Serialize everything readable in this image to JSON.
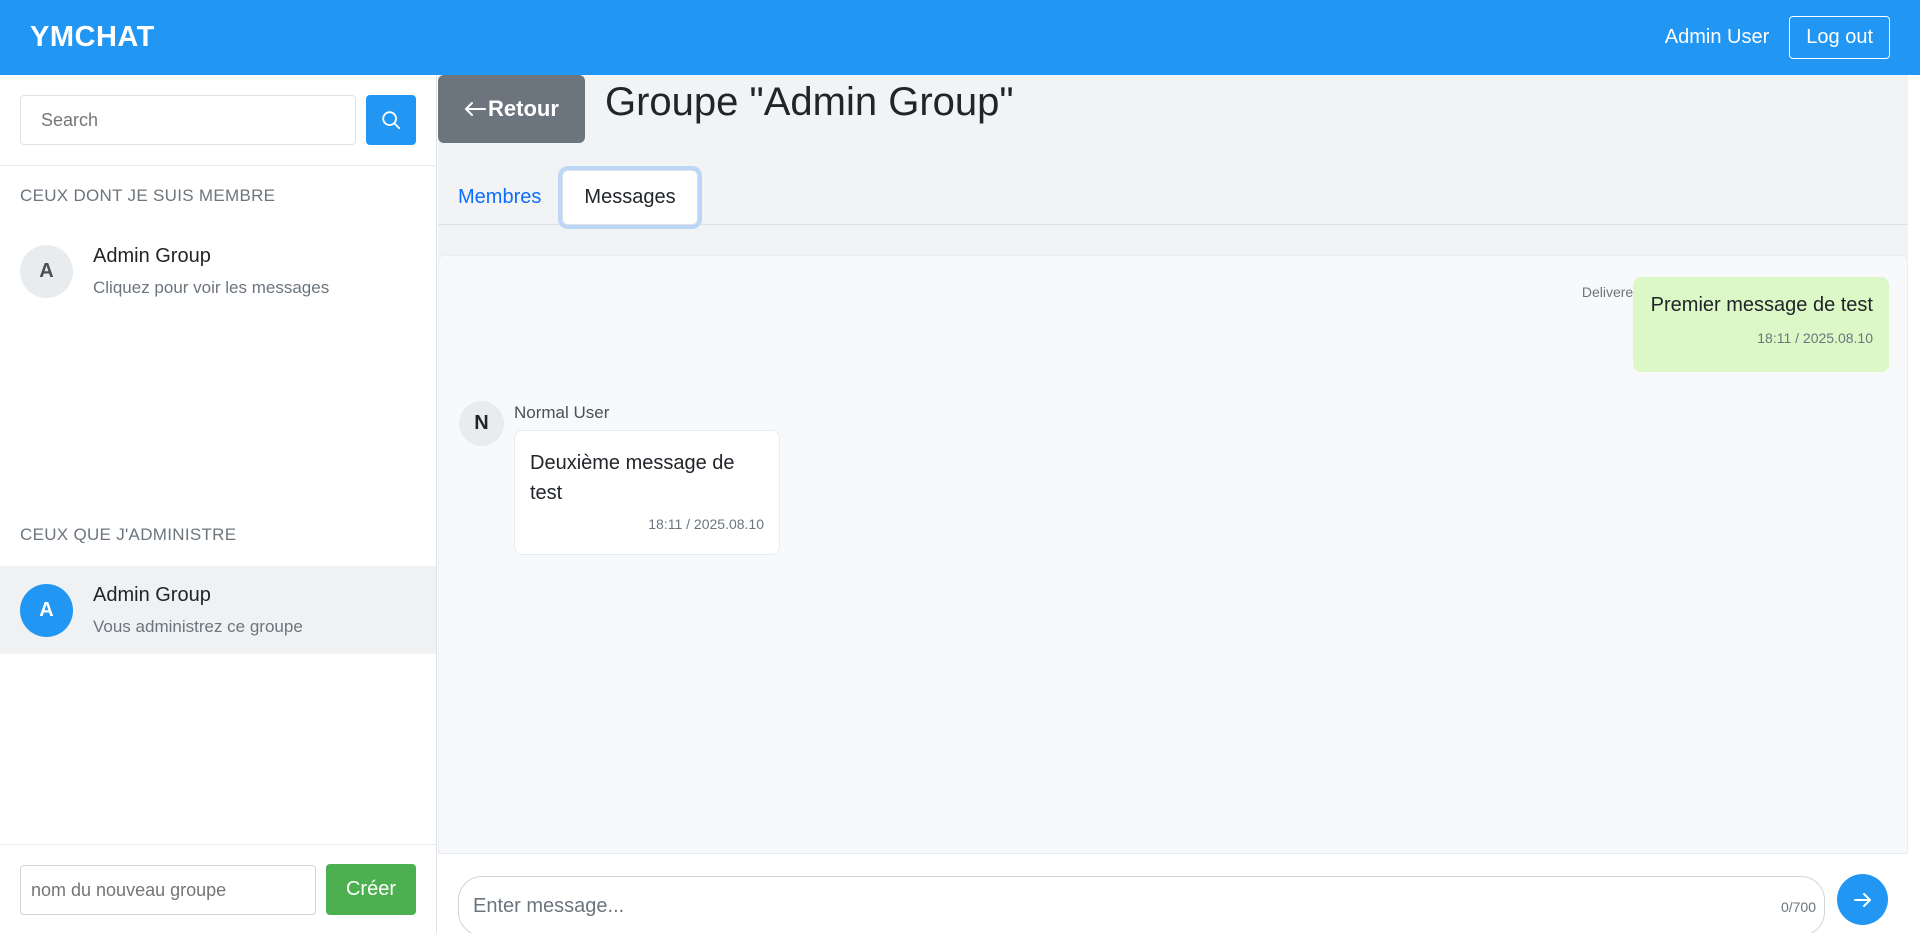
{
  "header": {
    "brand": "YMCHAT",
    "user_name": "Admin User",
    "logout_label": "Log out"
  },
  "sidebar": {
    "search_placeholder": "Search",
    "member_section_title": "CEUX DONT JE SUIS MEMBRE",
    "member_groups": [
      {
        "avatar_letter": "A",
        "name": "Admin Group",
        "subtitle": "Cliquez pour voir les messages"
      }
    ],
    "admin_section_title": "CEUX QUE J'ADMINISTRE",
    "admin_groups": [
      {
        "avatar_letter": "A",
        "name": "Admin Group",
        "subtitle": "Vous administrez ce groupe"
      }
    ],
    "new_group_placeholder": "nom du nouveau groupe",
    "create_label": "Créer"
  },
  "main": {
    "back_label": "Retour",
    "title": "Groupe \"Admin Group\"",
    "tabs": [
      {
        "label": "Membres",
        "active": false
      },
      {
        "label": "Messages",
        "active": true
      }
    ],
    "messages": [
      {
        "mine": true,
        "status": "Delivered",
        "text": "Premier message de test",
        "time": "18:11 / 2025.08.10"
      },
      {
        "mine": false,
        "sender": "Normal User",
        "avatar_letter": "N",
        "text": "Deuxième message de test",
        "time": "18:11 / 2025.08.10"
      }
    ],
    "composer": {
      "placeholder": "Enter message...",
      "counter": "0/700"
    }
  },
  "colors": {
    "primary": "#2196f3",
    "success": "#4caf50",
    "secondary": "#6c757d",
    "bubble_mine": "#dcf8c6"
  },
  "icons": {
    "search": "search-icon",
    "back": "arrow-left-icon",
    "send": "arrow-right-icon"
  }
}
